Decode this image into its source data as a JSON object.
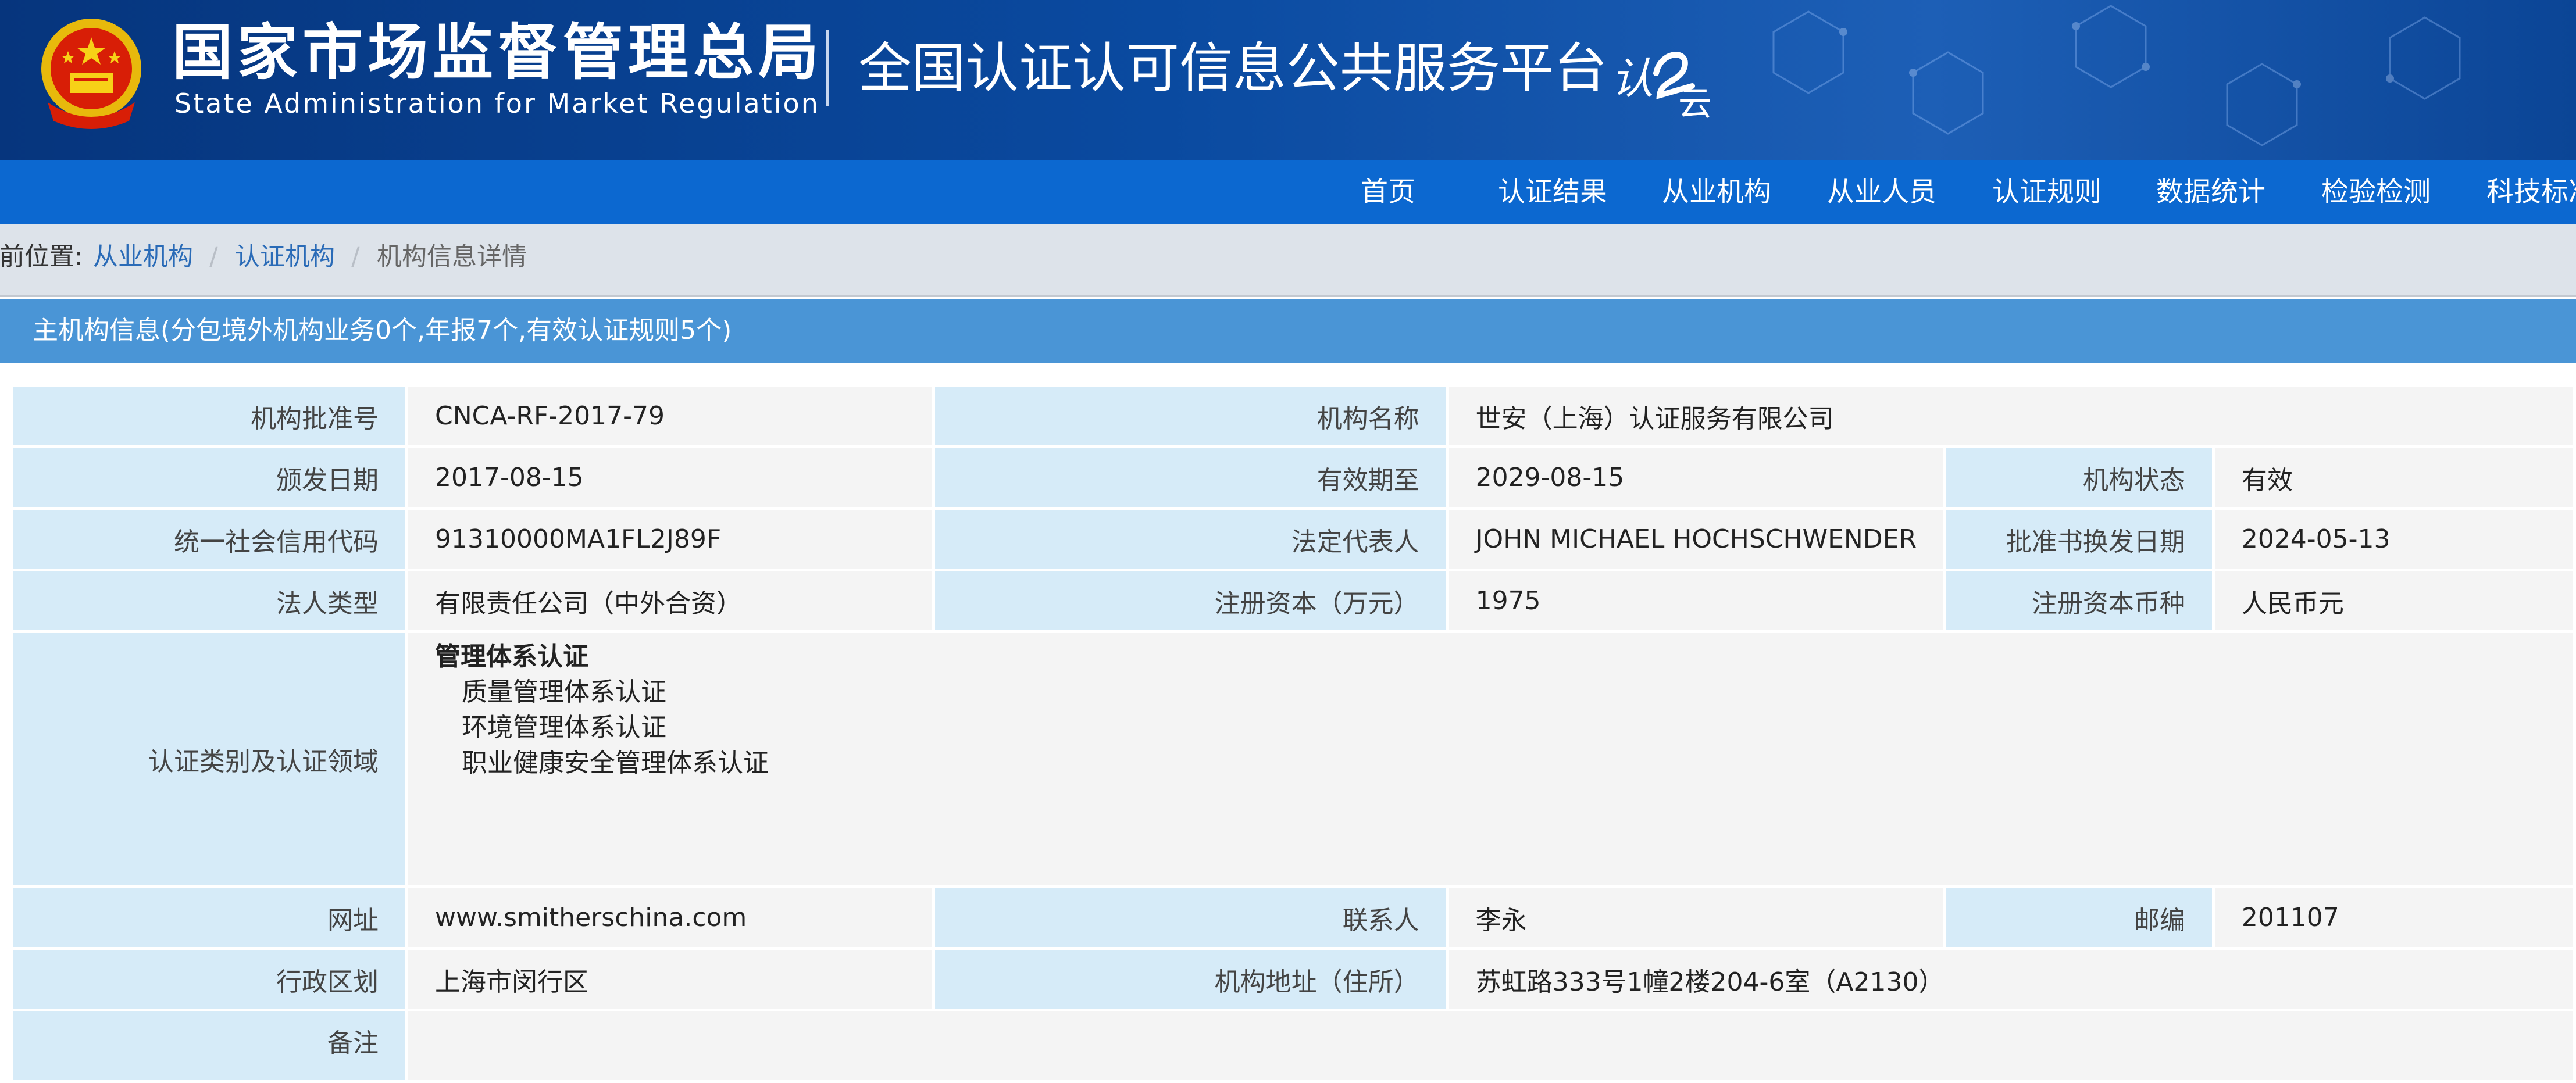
{
  "header": {
    "title_cn": "国家市场监督管理总局",
    "title_en": "State Administration  for  Market Regulation",
    "platform_name": "全国认证认可信息公共服务平台",
    "platform_logo_text": "认云",
    "emblem_icon": "national-emblem-icon",
    "colors": {
      "header_bg": "#0a4aa0",
      "nav_bg": "#0c68d0",
      "section_bg": "#4a95d6",
      "label_bg": "#d6ebf8"
    }
  },
  "nav": {
    "items": [
      "首页",
      "认证结果",
      "从业机构",
      "从业人员",
      "认证规则",
      "数据统计",
      "检验检测",
      "科技标准"
    ]
  },
  "breadcrumb": {
    "prefix": "当前位置:",
    "links": [
      "从业机构",
      "认证机构"
    ],
    "separator": "/",
    "current": "机构信息详情"
  },
  "section": {
    "heading": "主机构信息(分包境外机构业务0个,年报7个,有效认证规则5个)"
  },
  "details": {
    "approval_no_label": "机构批准号",
    "approval_no": "CNCA-RF-2017-79",
    "name_label": "机构名称",
    "name": "世安（上海）认证服务有限公司",
    "issue_date_label": "颁发日期",
    "issue_date": "2017-08-15",
    "valid_until_label": "有效期至",
    "valid_until": "2029-08-15",
    "status_label": "机构状态",
    "status": "有效",
    "credit_code_label": "统一社会信用代码",
    "credit_code": "91310000MA1FL2J89F",
    "legal_rep_label": "法定代表人",
    "legal_rep": "JOHN MICHAEL HOCHSCHWENDER",
    "renewal_date_label": "批准书换发日期",
    "renewal_date": "2024-05-13",
    "legal_type_label": "法人类型",
    "legal_type": "有限责任公司（中外合资）",
    "capital_label": "注册资本（万元）",
    "capital": "1975",
    "currency_label": "注册资本币种",
    "currency": "人民币元",
    "scope_label": "认证类别及认证领域",
    "scope": {
      "category": "管理体系认证",
      "items": [
        "质量管理体系认证",
        "环境管理体系认证",
        "职业健康安全管理体系认证"
      ]
    },
    "website_label": "网址",
    "website": "www.smitherschina.com",
    "contact_label": "联系人",
    "contact": "李永",
    "postcode_label": "邮编",
    "postcode": "201107",
    "district_label": "行政区划",
    "district": "上海市闵行区",
    "address_label": "机构地址（住所）",
    "address": "苏虹路333号1幢2楼204-6室（A2130）",
    "remark_label": "备注",
    "remark": ""
  }
}
